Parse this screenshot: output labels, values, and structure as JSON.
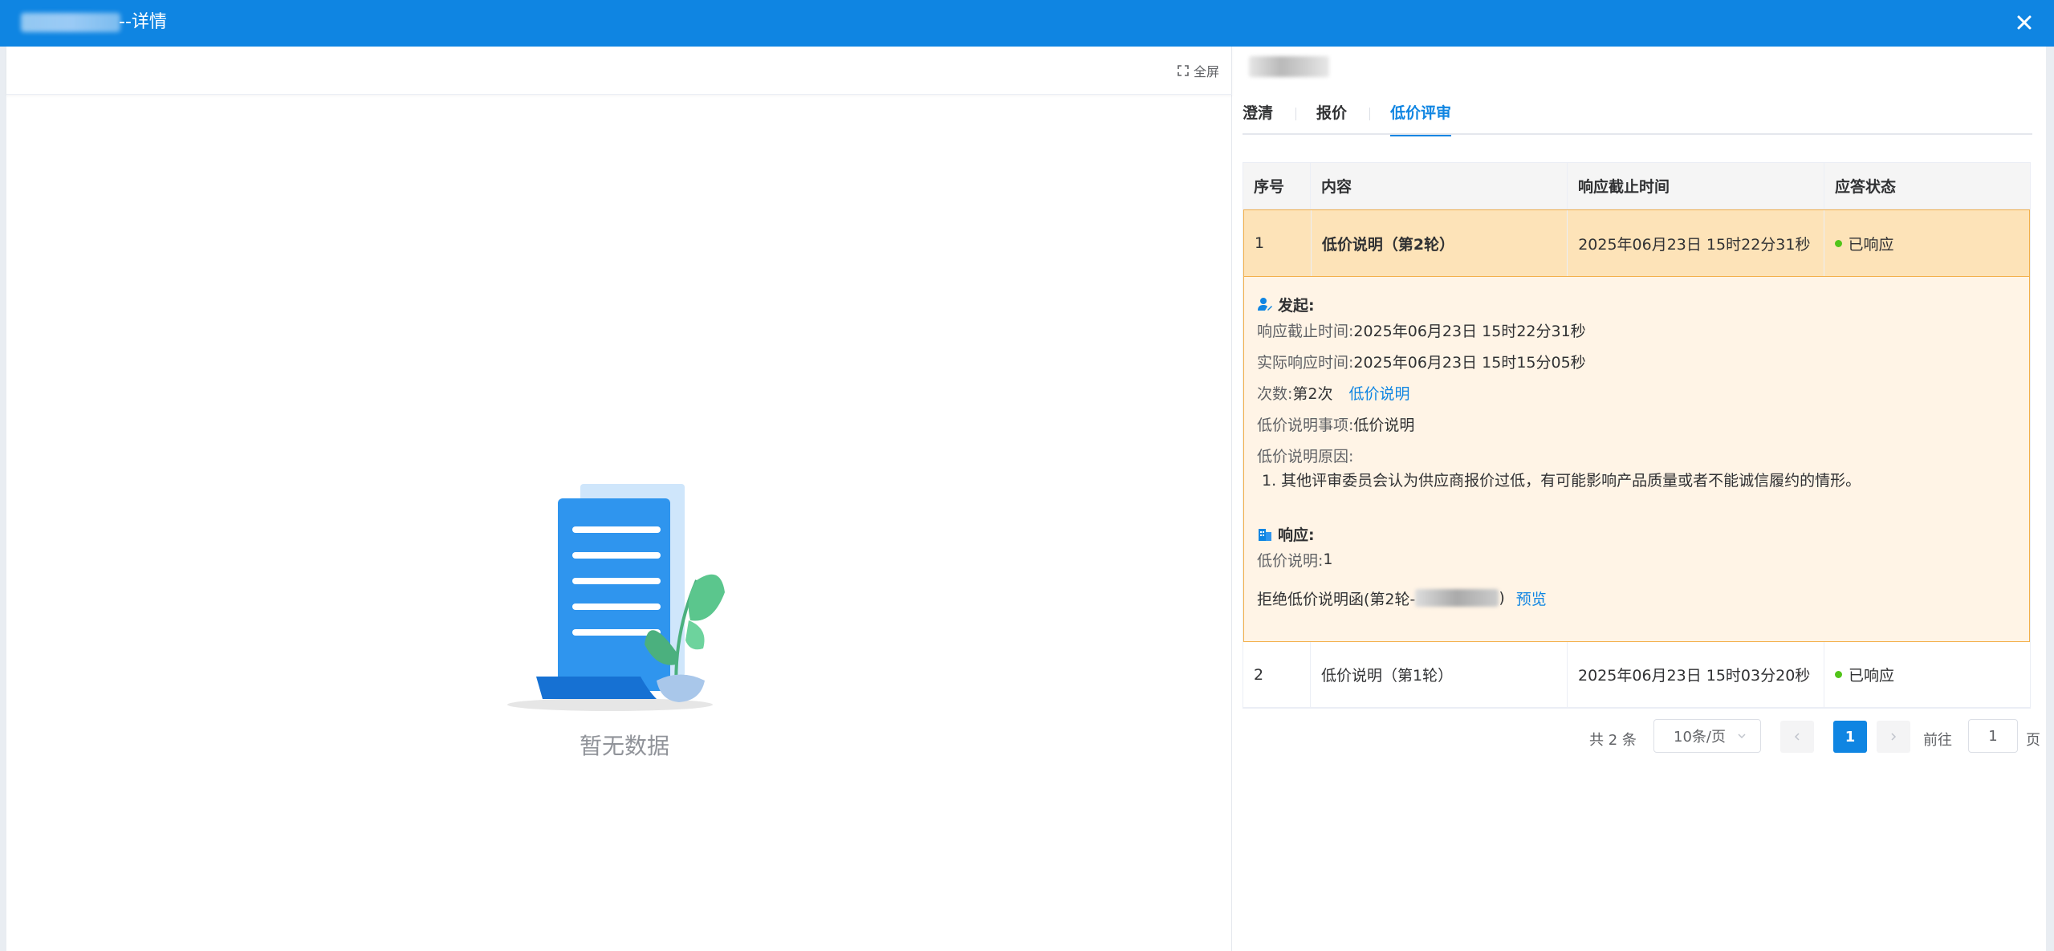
{
  "titlebar": {
    "title": "--详情",
    "close_icon": "close-icon"
  },
  "left": {
    "fullscreen_label": "全屏",
    "empty_text": "暂无数据"
  },
  "tabs": [
    {
      "label": "澄清"
    },
    {
      "label": "报价"
    },
    {
      "label": "低价评审"
    }
  ],
  "table": {
    "headers": [
      "序号",
      "内容",
      "响应截止时间",
      "应答状态"
    ],
    "rows": [
      {
        "index": "1",
        "content": "低价说明（第2轮）",
        "deadline": "2025年06月23日 15时22分31秒",
        "status": "已响应"
      },
      {
        "index": "2",
        "content": "低价说明（第1轮）",
        "deadline": "2025年06月23日 15时03分20秒",
        "status": "已响应"
      }
    ],
    "expanded": {
      "initiate_title": "发起:",
      "deadline_label": "响应截止时间:",
      "deadline_value": "2025年06月23日 15时22分31秒",
      "actual_label": "实际响应时间:",
      "actual_value": "2025年06月23日 15时15分05秒",
      "count_label": "次数:",
      "count_value": "第2次",
      "count_link": "低价说明",
      "item_label": "低价说明事项:",
      "item_value": "低价说明",
      "reason_label": "低价说明原因:",
      "reason_text": "1. 其他评审委员会认为供应商报价过低，有可能影响产品质量或者不能诚信履约的情形。",
      "response_title": "响应:",
      "response_label": "低价说明:",
      "response_value": "1",
      "attachment_prefix": "拒绝低价说明函(第2轮-",
      "attachment_suffix": ")",
      "preview_link": "预览"
    }
  },
  "pagination": {
    "total": "共 2 条",
    "page_size": "10条/页",
    "current_page": "1",
    "goto_label": "前往",
    "goto_value": "1",
    "page_suffix": "页"
  },
  "colors": {
    "brand": "#0f85e2",
    "selected_row": "#fde3b8",
    "expand_bg": "#fff4e6",
    "status_ok": "#52c41a"
  }
}
